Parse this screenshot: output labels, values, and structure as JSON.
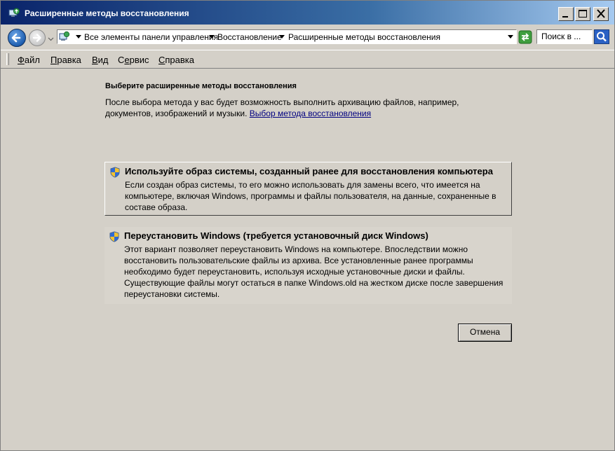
{
  "window": {
    "title": "Расширенные методы восстановления",
    "buttons": [
      "minimize",
      "maximize",
      "close"
    ]
  },
  "address_bar": {
    "breadcrumbs": [
      "Все элементы панели управления",
      "Восстановление",
      "Расширенные методы восстановления"
    ],
    "search_placeholder": "Поиск в ..."
  },
  "menu": {
    "items": [
      {
        "label": "Файл",
        "access": "Ф",
        "rest": "айл"
      },
      {
        "label": "Правка",
        "access": "П",
        "rest": "равка"
      },
      {
        "label": "Вид",
        "access": "В",
        "rest": "ид"
      },
      {
        "label": "Сервис",
        "pre": "С",
        "access": "е",
        "rest": "рвис"
      },
      {
        "label": "Справка",
        "access": "С",
        "rest": "правка"
      }
    ]
  },
  "main": {
    "heading": "Выберите расширенные методы восстановления",
    "description": "После выбора метода у вас будет возможность выполнить архивацию файлов, например, документов, изображений и музыки.",
    "link": "Выбор метода восстановления",
    "options": [
      {
        "title": "Используйте образ системы, созданный ранее для восстановления компьютера",
        "body": "Если создан образ системы, то его можно использовать для замены всего, что имеется на компьютере, включая Windows, программы и файлы пользователя, на данные, сохраненные в составе образа."
      },
      {
        "title": "Переустановить Windows (требуется установочный диск Windows)",
        "body": "Этот вариант позволяет переустановить Windows на компьютере. Впоследствии можно восстановить пользовательские файлы из архива. Все установленные ранее программы необходимо будет переустановить, используя исходные установочные диски и файлы. Существующие файлы могут остаться в папке Windows.old на жестком диске после завершения переустановки системы."
      }
    ],
    "cancel_label": "Отмена"
  }
}
